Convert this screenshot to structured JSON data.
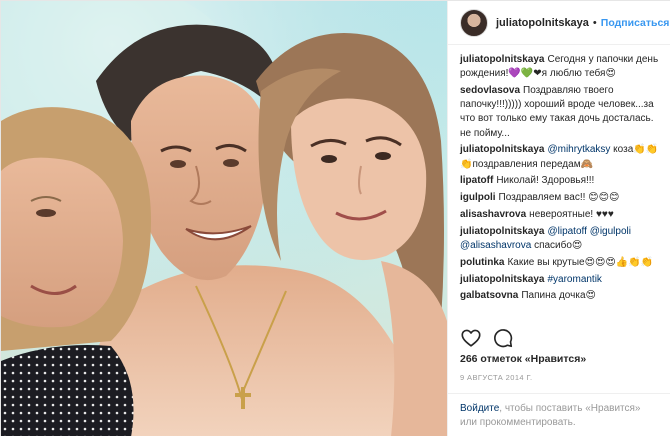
{
  "header": {
    "username": "juliatopolnitskaya",
    "separator": "•",
    "follow_label": "Подписаться"
  },
  "comments": [
    {
      "user": "juliatopolnitskaya",
      "text": "Сегодня у папочки день рождения!💜💚❤я люблю тебя😍"
    },
    {
      "user": "sedovlasova",
      "text": "Поздравляю твоего папочку!!!))))) хороший вроде человек...за что вот только ему такая дочь досталась. не пойму..."
    },
    {
      "user": "juliatopolnitskaya",
      "mention": "@mihrytkaksy",
      "text": " коза👏👏👏поздравления передам🙈"
    },
    {
      "user": "lipatoff",
      "text": "Николай! Здоровья!!!"
    },
    {
      "user": "igulpoli",
      "text": "Поздравляем вас!! 😊😊😊"
    },
    {
      "user": "alisashavrova",
      "text": "невероятные! ♥♥♥"
    },
    {
      "user": "juliatopolnitskaya",
      "mention": "@lipatoff",
      "mention2": "@igulpoli",
      "mention3": "@alisashavrova",
      "text": " спасибо😍"
    },
    {
      "user": "polutinka",
      "text": "Какие вы крутые😍😍😍👍👏👏"
    },
    {
      "user": "juliatopolnitskaya",
      "mention": "#yaromantik",
      "text": ""
    },
    {
      "user": "galbatsovna",
      "text": "Папина дочка😍"
    }
  ],
  "actions": {
    "like_icon": "heart-outline-icon",
    "comment_icon": "speech-bubble-icon"
  },
  "likes_text": "266 отметок «Нравится»",
  "date_text": "9 августа 2014 г.",
  "login": {
    "link": "Войдите",
    "text": ", чтобы поставить «Нравится» или прокомментировать."
  },
  "colors": {
    "link_blue": "#3897f0",
    "mention_blue": "#003569",
    "muted": "#999999",
    "text": "#262626"
  }
}
